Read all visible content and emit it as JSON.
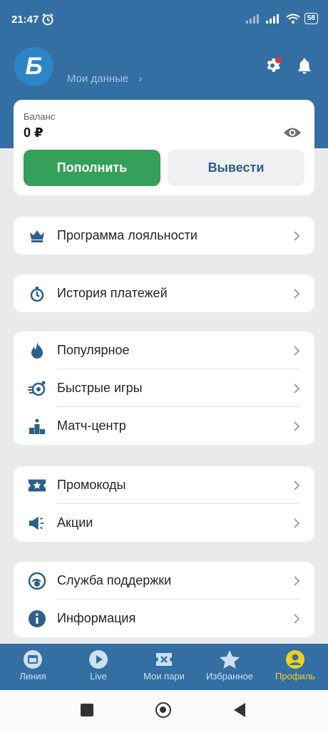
{
  "status": {
    "time": "21:47",
    "battery": "58"
  },
  "header": {
    "logo_letter": "Б",
    "my_data_label": "Мои данные"
  },
  "balance": {
    "label": "Баланс",
    "value": "0 ₽",
    "deposit_label": "Пополнить",
    "withdraw_label": "Вывести"
  },
  "menu": {
    "loyalty": "Программа лояльности",
    "payments": "История платежей",
    "popular": "Популярное",
    "fast_games": "Быстрые игры",
    "match_center": "Матч-центр",
    "promocodes": "Промокоды",
    "promotions": "Акции",
    "support": "Служба поддержки",
    "info": "Информация"
  },
  "tabs": [
    {
      "label": "Линия",
      "icon": "calendar-icon"
    },
    {
      "label": "Live",
      "icon": "play-icon"
    },
    {
      "label": "Мои пари",
      "icon": "ticket-icon"
    },
    {
      "label": "Избранное",
      "icon": "star-icon"
    },
    {
      "label": "Профиль",
      "icon": "profile-icon",
      "active": true
    }
  ],
  "colors": {
    "brand": "#336fa3",
    "accent_green": "#35a05a",
    "active_tab": "#f4d020",
    "icon_blue": "#2e5f8a"
  }
}
